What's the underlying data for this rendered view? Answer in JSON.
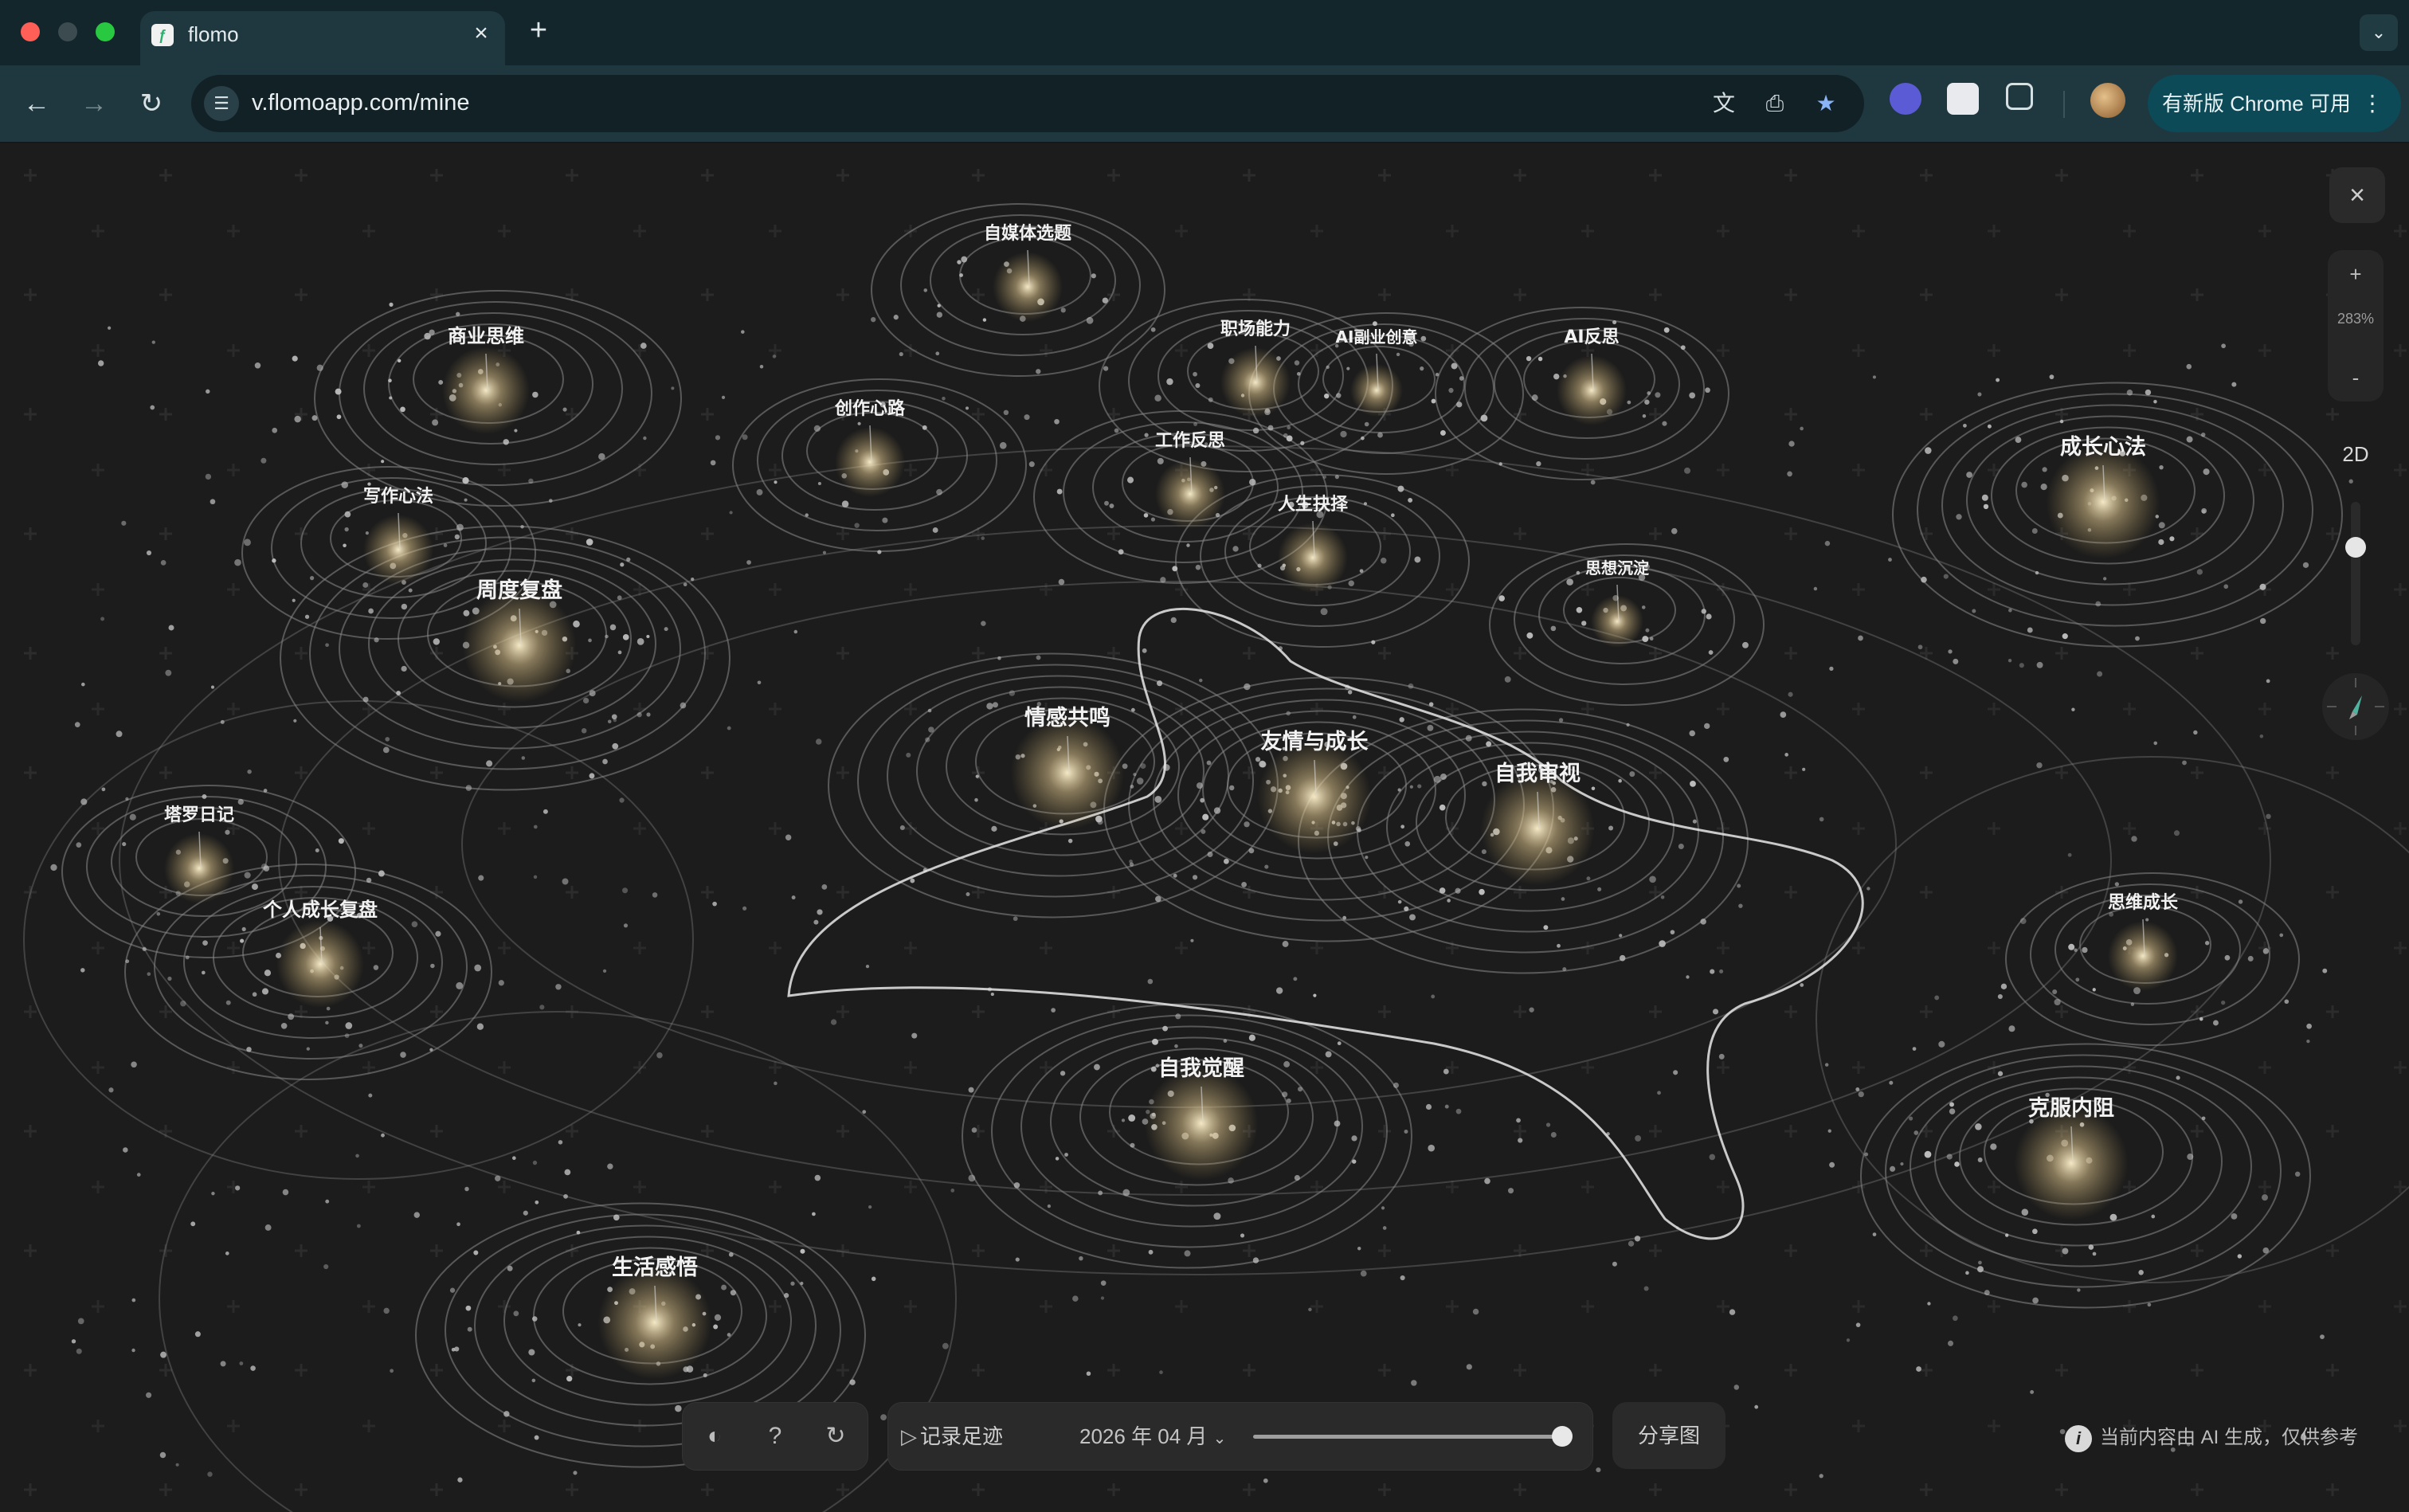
{
  "browser": {
    "tab_title": "flomo",
    "tab_favicon": "flomo-icon",
    "url": "v.flomoapp.com/mine",
    "update_label": "有新版 Chrome 可用",
    "colors": {
      "tabbar": "#13262c",
      "toolbar": "#1f3840",
      "update_button": "#0d4a57"
    }
  },
  "map": {
    "topics": [
      {
        "label": "自媒体选题",
        "size": "small"
      },
      {
        "label": "商业思维",
        "size": "medium"
      },
      {
        "label": "职场能力",
        "size": "small"
      },
      {
        "label": "AI副业创意",
        "size": "tiny"
      },
      {
        "label": "AI反思",
        "size": "small"
      },
      {
        "label": "创作心路",
        "size": "small"
      },
      {
        "label": "工作反思",
        "size": "small"
      },
      {
        "label": "成长心法",
        "size": "large"
      },
      {
        "label": "写作心法",
        "size": "small"
      },
      {
        "label": "人生抉择",
        "size": "small"
      },
      {
        "label": "周度复盘",
        "size": "large"
      },
      {
        "label": "思想沉淀",
        "size": "tiny"
      },
      {
        "label": "情感共鸣",
        "size": "large"
      },
      {
        "label": "友情与成长",
        "size": "large"
      },
      {
        "label": "自我审视",
        "size": "large"
      },
      {
        "label": "塔罗日记",
        "size": "small"
      },
      {
        "label": "个人成长复盘",
        "size": "medium"
      },
      {
        "label": "思维成长",
        "size": "small"
      },
      {
        "label": "自我觉醒",
        "size": "large"
      },
      {
        "label": "克服内阻",
        "size": "large"
      },
      {
        "label": "生活感悟",
        "size": "large"
      }
    ],
    "zoom_percent": "283%",
    "zoom_in": "+",
    "zoom_out": "-",
    "view_mode": "2D",
    "close_icon": "close-icon"
  },
  "controls": {
    "play_label": "记录足迹",
    "month": "2026 年 04 月",
    "timeline_progress": 1.0,
    "share_label": "分享图",
    "disclaimer": "当前内容由 AI 生成，仅供参考"
  }
}
